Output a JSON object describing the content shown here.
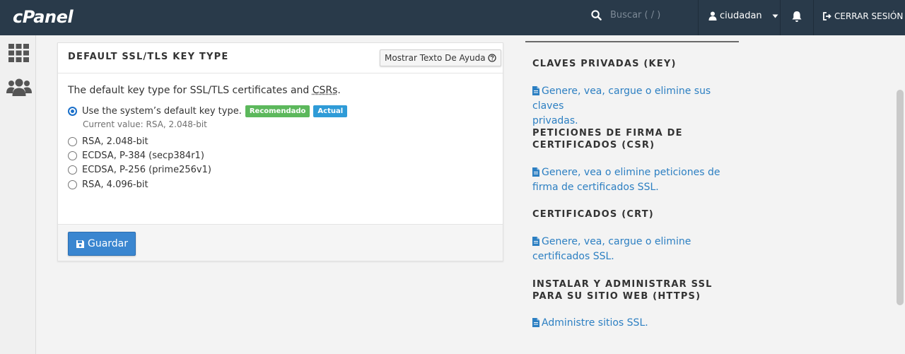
{
  "topbar": {
    "logo": "cPanel",
    "search_placeholder": "Buscar ( / )",
    "username": "ciudadan",
    "logout_label": "CERRAR SESIÓN"
  },
  "panel": {
    "title": "DEFAULT SSL/TLS KEY TYPE",
    "help_button": "Mostrar Texto De Ayuda",
    "intro_prefix": "The default key type for SSL/TLS certificates and ",
    "intro_abbr": "CSRs",
    "intro_suffix": ".",
    "options": [
      {
        "label": "Use the system’s default key type.",
        "checked": true
      },
      {
        "label": "RSA, 2.048-bit",
        "checked": false
      },
      {
        "label": "ECDSA, P-384 (secp384r1)",
        "checked": false
      },
      {
        "label": "ECDSA, P-256 (prime256v1)",
        "checked": false
      },
      {
        "label": "RSA, 4.096-bit",
        "checked": false
      }
    ],
    "badge_recommended": "Recomendado",
    "badge_current": "Actual",
    "current_value": "Current value: RSA, 2.048-bit",
    "save_button": "Guardar"
  },
  "sidebar_right": {
    "sections": [
      {
        "title_line1": "CLAVES PRIVADAS (KEY)",
        "title_line2": "",
        "link_line1": "Genere, vea, cargue o elimine sus claves",
        "link_line2": "privadas."
      },
      {
        "title_line1": "PETICIONES DE FIRMA DE",
        "title_line2": "CERTIFICADOS (CSR)",
        "link_line1": "Genere, vea o elimine peticiones de",
        "link_line2": "firma de certificados SSL."
      },
      {
        "title_line1": "CERTIFICADOS (CRT)",
        "title_line2": "",
        "link_line1": "Genere, vea, cargue o elimine",
        "link_line2": "certificados SSL."
      },
      {
        "title_line1": "INSTALAR Y ADMINISTRAR SSL",
        "title_line2": "PARA SU SITIO WEB (HTTPS)",
        "link_line1": "Administre sitios SSL.",
        "link_line2": ""
      }
    ]
  },
  "colors": {
    "topbar": "#293a4a",
    "primary_button": "#3a86d0",
    "link": "#2c7fc2",
    "badge_recommended": "#5cb85c",
    "badge_current": "#2f9bd7"
  },
  "icons": [
    "search-icon",
    "user-icon",
    "chevron-down-icon",
    "bell-icon",
    "logout-icon",
    "apps-grid-icon",
    "users-icon",
    "question-circle-icon",
    "save-icon",
    "document-icon"
  ]
}
